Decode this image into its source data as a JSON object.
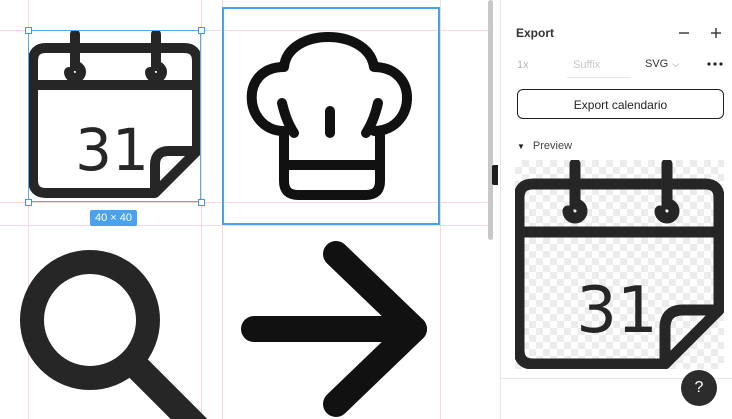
{
  "canvas": {
    "selection_size_label": "40 × 40",
    "icons": [
      {
        "name": "calendar-icon",
        "day": "31"
      },
      {
        "name": "chef-hat-icon"
      },
      {
        "name": "search-icon"
      },
      {
        "name": "arrow-right-icon"
      }
    ]
  },
  "export_panel": {
    "title": "Export",
    "remove_icon": "minus-icon",
    "add_icon": "plus-icon",
    "scale": "1x",
    "suffix_placeholder": "Suffix",
    "format": "SVG",
    "more_icon": "more-dots-icon",
    "export_button_label": "Export calendario",
    "preview_label": "Preview",
    "preview_day": "31"
  },
  "help_button": {
    "label": "?"
  }
}
